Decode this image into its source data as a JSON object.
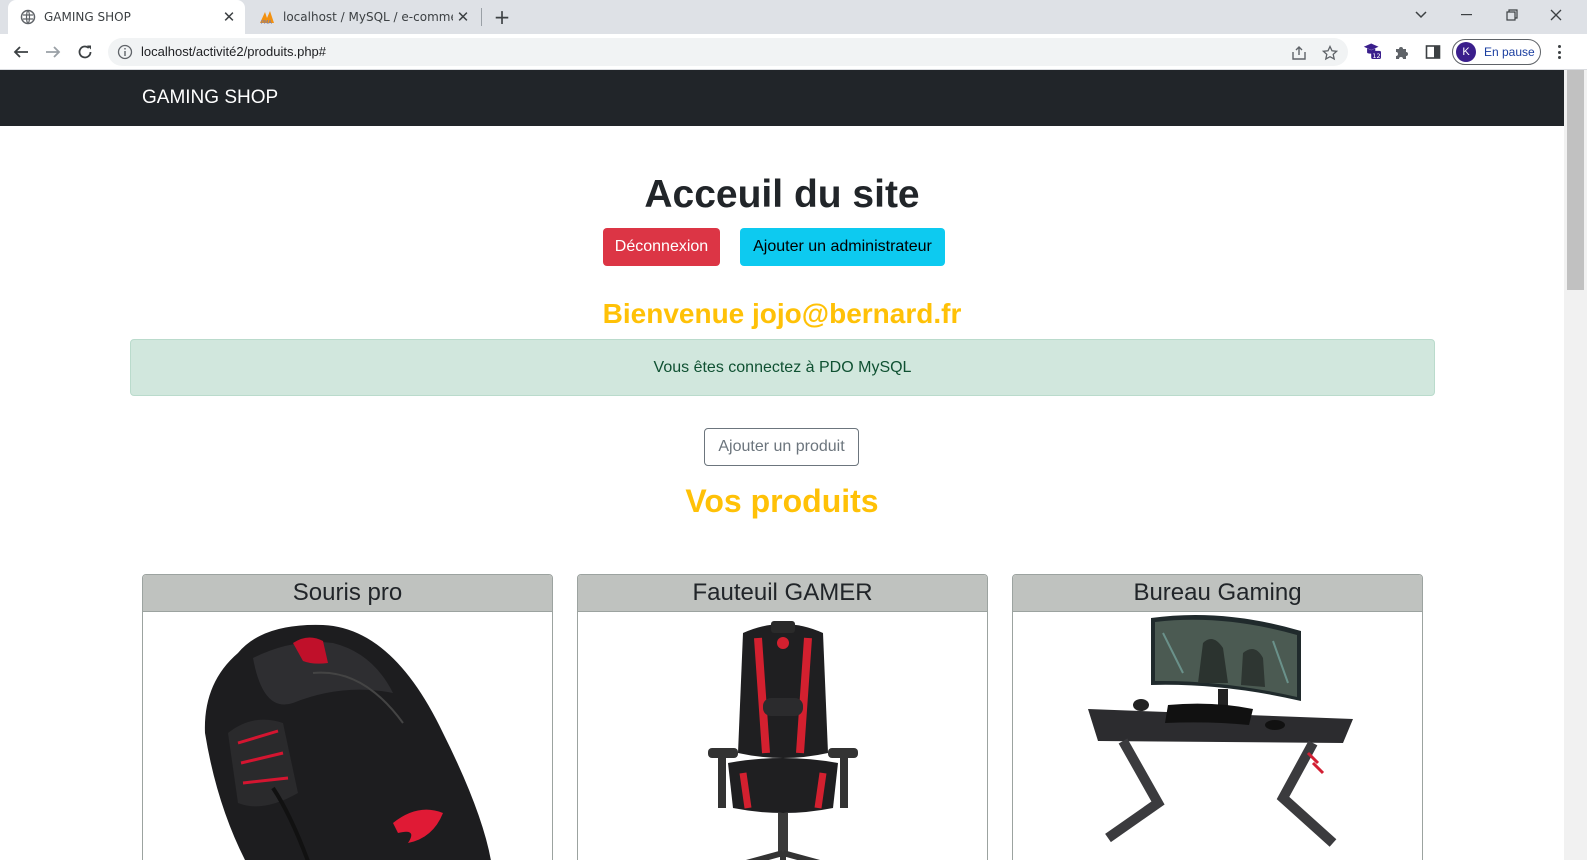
{
  "browser": {
    "tabs": [
      {
        "title": "GAMING SHOP",
        "active": true
      },
      {
        "title": "localhost / MySQL / e-commerce",
        "active": false
      }
    ],
    "url": "localhost/activité2/produits.php#",
    "profile_status": "En pause",
    "profile_initial": "K",
    "extension_badge": "12"
  },
  "site": {
    "brand": "GAMING SHOP",
    "heading": "Acceuil du site",
    "logout_label": "Déconnexion",
    "add_admin_label": "Ajouter un administrateur",
    "welcome": "Bienvenue jojo@bernard.fr",
    "alert": "Vous êtes connectez à PDO MySQL",
    "add_product_label": "Ajouter un produit",
    "products_heading": "Vos produits"
  },
  "products": [
    {
      "name": "Souris pro",
      "image": "gaming-mouse"
    },
    {
      "name": "Fauteuil GAMER",
      "image": "gaming-chair"
    },
    {
      "name": "Bureau Gaming",
      "image": "gaming-desk"
    }
  ],
  "colors": {
    "navbar": "#212529",
    "danger": "#dc3545",
    "info": "#0dcaf0",
    "warning": "#ffc107",
    "alert_bg": "#d1e7dd"
  }
}
